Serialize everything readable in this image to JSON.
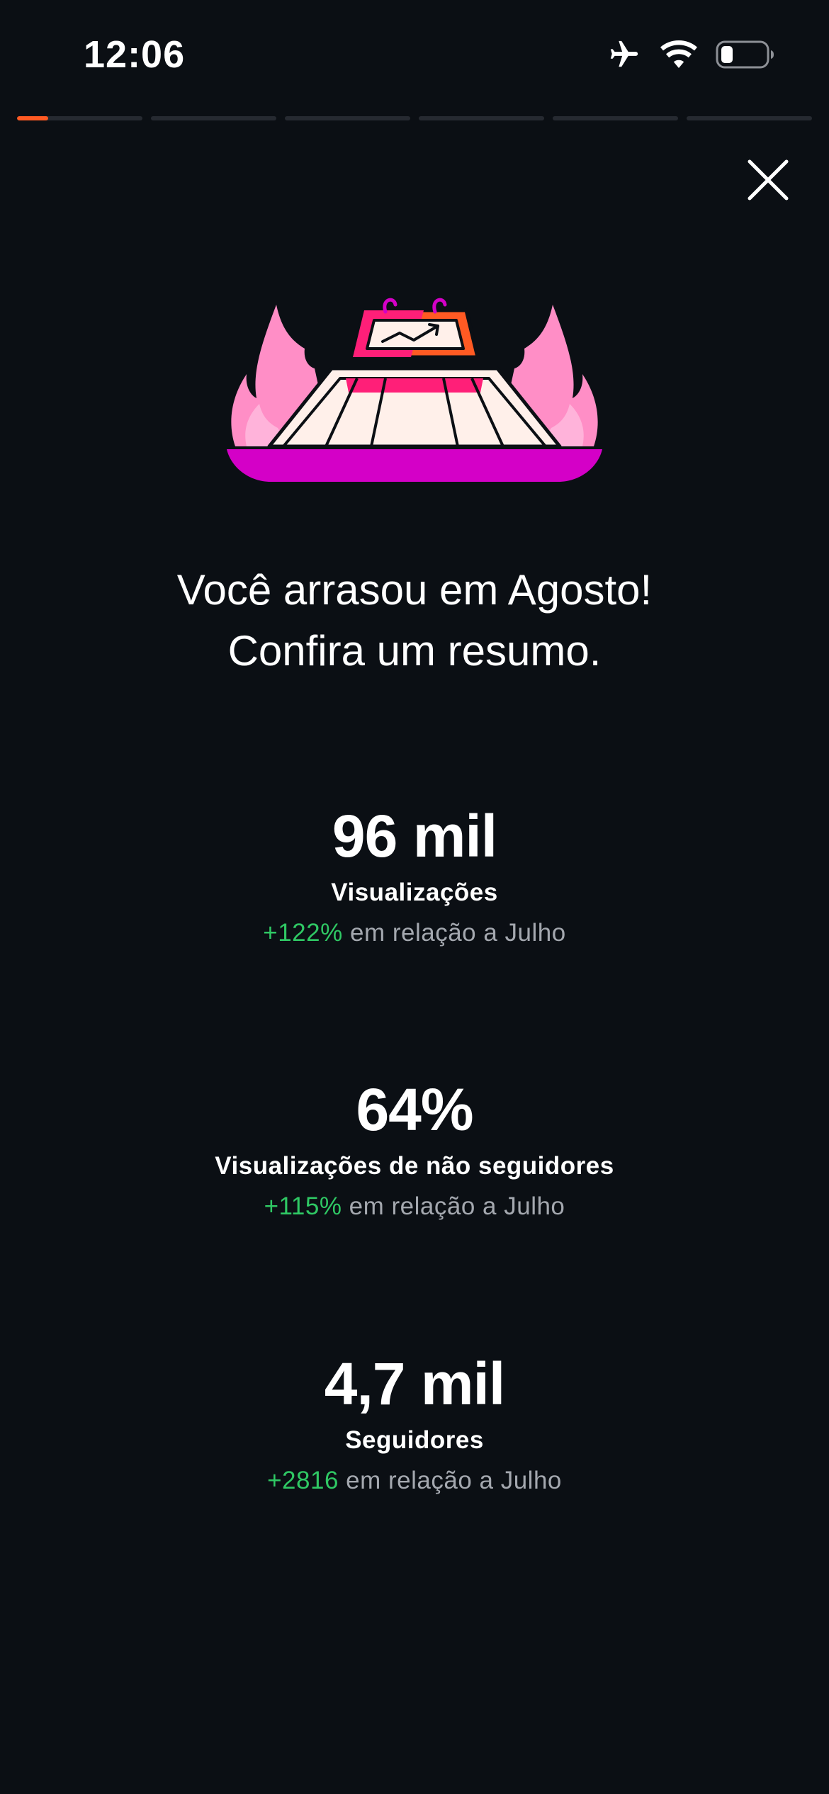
{
  "status_bar": {
    "time": "12:06",
    "icons": [
      "airplane-icon",
      "wifi-icon",
      "battery-icon"
    ]
  },
  "progress": {
    "segments": 6,
    "active_index": 0,
    "active_fraction": 0.25,
    "active_color": "#ff5a23",
    "track_color": "#262a31"
  },
  "close": {
    "icon": "close-icon"
  },
  "illustration": {
    "icon": "fire-chart-stage-illustration"
  },
  "headline": {
    "line1": "Você arrasou em Agosto!",
    "line2": "Confira um resumo."
  },
  "stats": [
    {
      "value": "96 mil",
      "label": "Visualizações",
      "delta": "+122%",
      "comparison": "em relação a Julho"
    },
    {
      "value": "64%",
      "label": "Visualizações de não seguidores",
      "delta": "+115%",
      "comparison": "em relação a Julho"
    },
    {
      "value": "4,7 mil",
      "label": "Seguidores",
      "delta": "+2816",
      "comparison": "em relação a Julho"
    }
  ],
  "colors": {
    "background": "#0b0f14",
    "positive": "#2fc864",
    "muted": "#a4a8af"
  }
}
